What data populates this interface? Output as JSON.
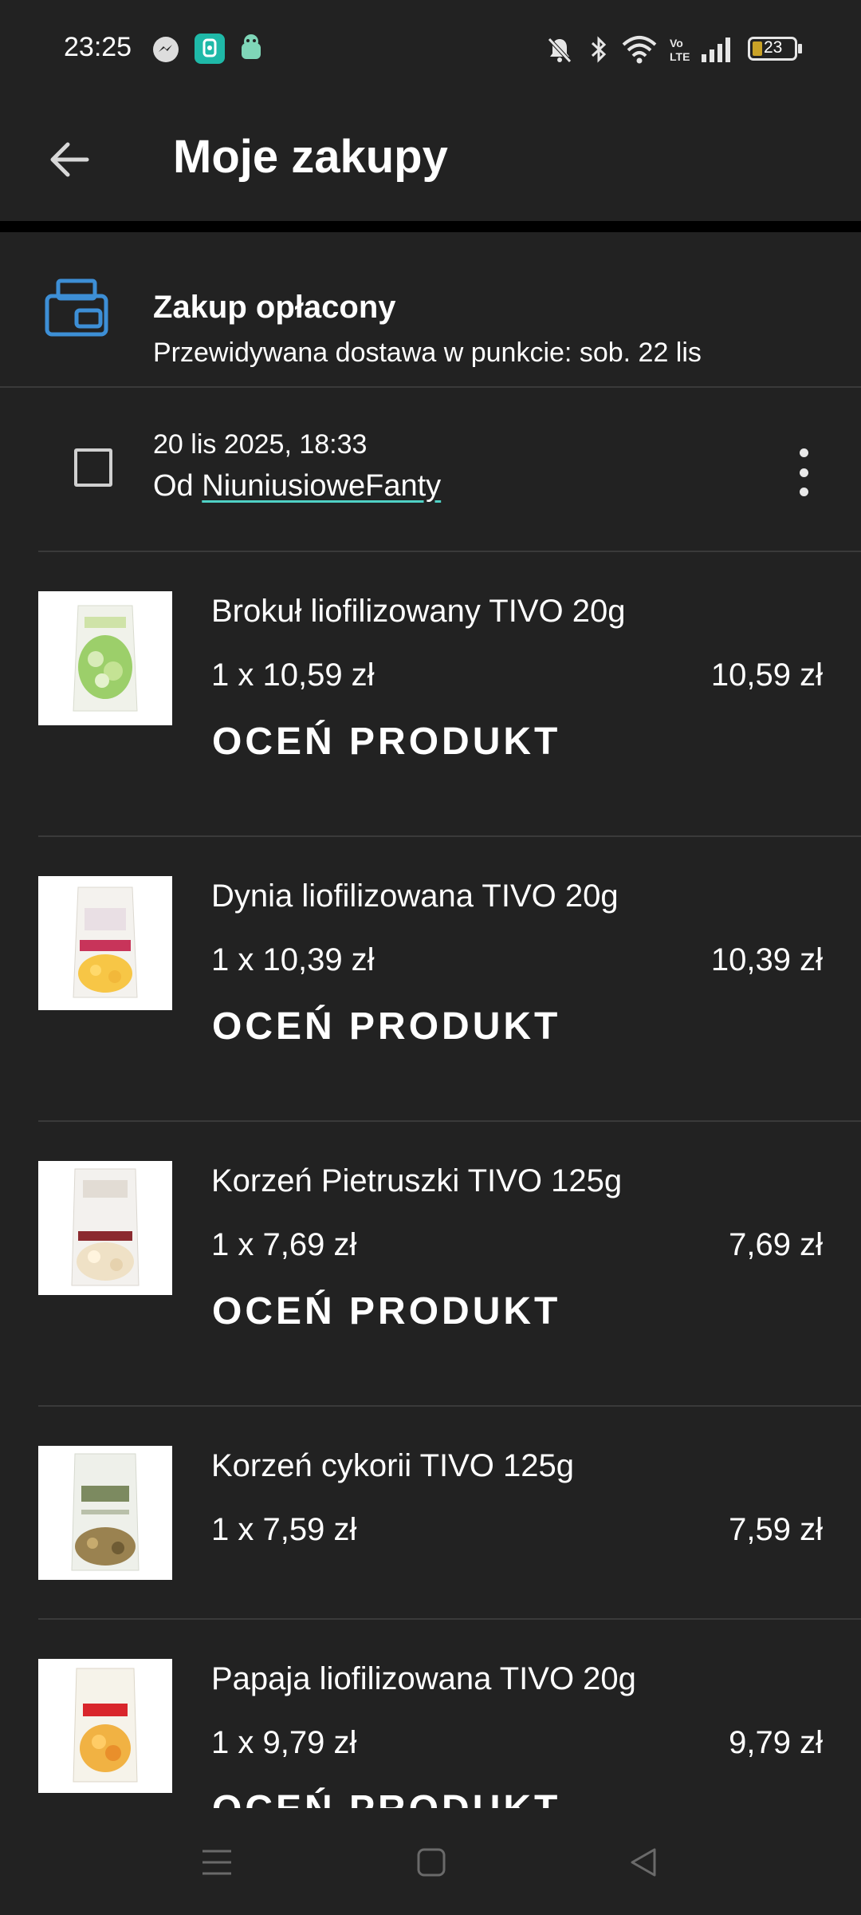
{
  "status_bar": {
    "time": "23:25",
    "battery": "23",
    "left_icons": [
      "messenger-icon",
      "app-green-icon",
      "android-icon"
    ],
    "right_icons": [
      "mute-icon",
      "bluetooth-icon",
      "wifi-icon",
      "volte-icon",
      "signal-icon",
      "battery-icon"
    ]
  },
  "header": {
    "title": "Moje zakupy",
    "back_icon": "back-arrow-icon"
  },
  "summary": {
    "icon": "printer-icon",
    "title": "Zakup opłacony",
    "subtitle": "Przewidywana dostawa w punkcie: sob. 22 lis"
  },
  "order": {
    "date": "20 lis 2025, 18:33",
    "seller_prefix": "Od",
    "seller_name": "NiuniusioweFanty",
    "menu_icon": "more-vert-icon"
  },
  "items": [
    {
      "name": "Brokuł liofilizowany TIVO 20g",
      "qty_price": "1 x 10,59 zł",
      "total": "10,59 zł",
      "rate_label": "OCEŃ PRODUKT"
    },
    {
      "name": "Dynia liofilizowana TIVO 20g",
      "qty_price": "1 x 10,39 zł",
      "total": "10,39 zł",
      "rate_label": "OCEŃ PRODUKT"
    },
    {
      "name": "Korzeń Pietruszki TIVO 125g",
      "qty_price": "1 x 7,69 zł",
      "total": "7,69 zł",
      "rate_label": "OCEŃ PRODUKT"
    },
    {
      "name": "Korzeń cykorii TIVO 125g",
      "qty_price": "1 x 7,59 zł",
      "total": "7,59 zł",
      "rate_label": ""
    },
    {
      "name": "Papaja liofilizowana TIVO 20g",
      "qty_price": "1 x 9,79 zł",
      "total": "9,79 zł",
      "rate_label": "OCEŃ PRODUKT"
    }
  ],
  "nav_bar": {
    "icons": [
      "menu-icon",
      "home-icon",
      "back-icon"
    ]
  },
  "colors": {
    "background": "#222222",
    "divider": "#3a3a3a",
    "accent_blue": "#3d8fd6",
    "link_underline": "#4fd1c5",
    "app_green": "#1fb9a8"
  }
}
